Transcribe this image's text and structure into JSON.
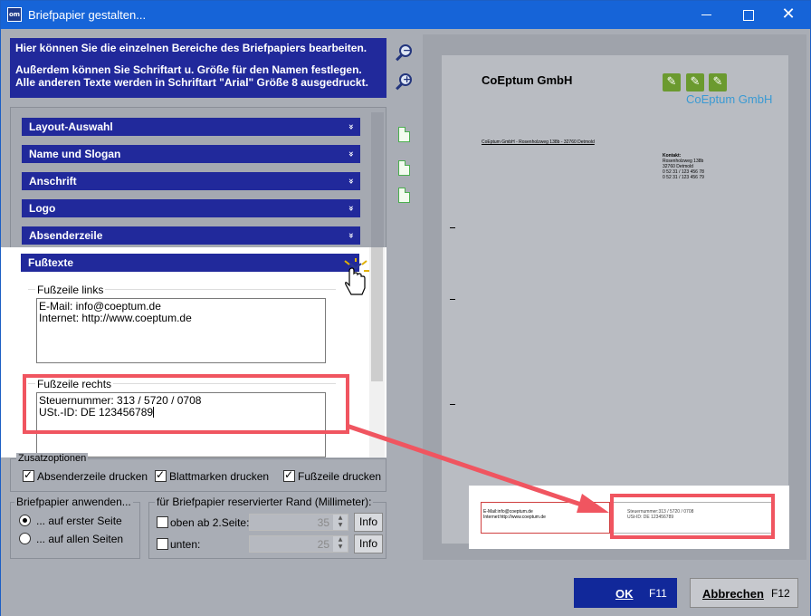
{
  "window": {
    "title": "Briefpapier gestalten...",
    "app_icon_text": "om",
    "close_glyph": "✕"
  },
  "info": {
    "line1": "Hier können Sie die einzelnen Bereiche des Briefpapiers bearbeiten.",
    "line2": "Außerdem können Sie Schriftart u. Größe für den Namen festlegen.",
    "line3": "Alle anderen Texte werden in Schriftart \"Arial\" Größe 8 ausgedruckt."
  },
  "sections": [
    {
      "label": "Layout-Auswahl",
      "state": "collapsed"
    },
    {
      "label": "Name und Slogan",
      "state": "collapsed"
    },
    {
      "label": "Anschrift",
      "state": "collapsed"
    },
    {
      "label": "Logo",
      "state": "collapsed"
    },
    {
      "label": "Absenderzeile",
      "state": "collapsed"
    },
    {
      "label": "Fußtexte",
      "state": "expanded"
    }
  ],
  "chevron_down": "»",
  "footer": {
    "left_label": "Fußzeile links",
    "left_text": "E-Mail: info@coeptum.de\nInternet: http://www.coeptum.de",
    "right_label": "Fußzeile rechts",
    "right_text": "Steuernummer: 313 / 5720 / 0708\nUSt.-ID: DE 123456789"
  },
  "zusatz": {
    "title": "Zusatzoptionen",
    "options": [
      {
        "label": "Absenderzeile drucken",
        "checked": true
      },
      {
        "label": "Blattmarken drucken",
        "checked": true
      },
      {
        "label": "Fußzeile drucken",
        "checked": true
      }
    ]
  },
  "anwenden": {
    "title": "Briefpapier anwenden...",
    "options": [
      {
        "label": "... auf erster Seite",
        "checked": true
      },
      {
        "label": "... auf allen Seiten",
        "checked": false
      }
    ]
  },
  "rand": {
    "title": "für Briefpapier reservierter Rand (Millimeter):",
    "rows": [
      {
        "label": "oben ab 2.Seite:",
        "value": "35",
        "button": "Info"
      },
      {
        "label": "unten:",
        "value": "25",
        "button": "Info"
      }
    ]
  },
  "preview": {
    "company": "CoEptum GmbH",
    "logo_text": "CoEptum GmbH",
    "sender_line": "CoEptum GmbH - Rosenholzweg 138b - 32760 Detmold",
    "contact": [
      "Kontakt:",
      "Rosenholzweg 138b",
      "32760 Detmold",
      "0 52 31 / 123 456 78",
      "0 52 31 / 123 456 79"
    ],
    "footer_left": [
      "E-Mail:info@coeptum.de",
      "Internet:http://www.coeptum.de"
    ],
    "footer_right": [
      "Steuernummer:313 / 5720 / 0708",
      "USt-ID: DE 123456789"
    ]
  },
  "buttons": {
    "ok_label": "OK",
    "ok_key": "F11",
    "cancel_label": "Abbrechen",
    "cancel_key": "F12"
  },
  "colors": {
    "title_bar": "#1664d8",
    "section_blue": "#21299b",
    "highlight_red": "#f05560"
  }
}
